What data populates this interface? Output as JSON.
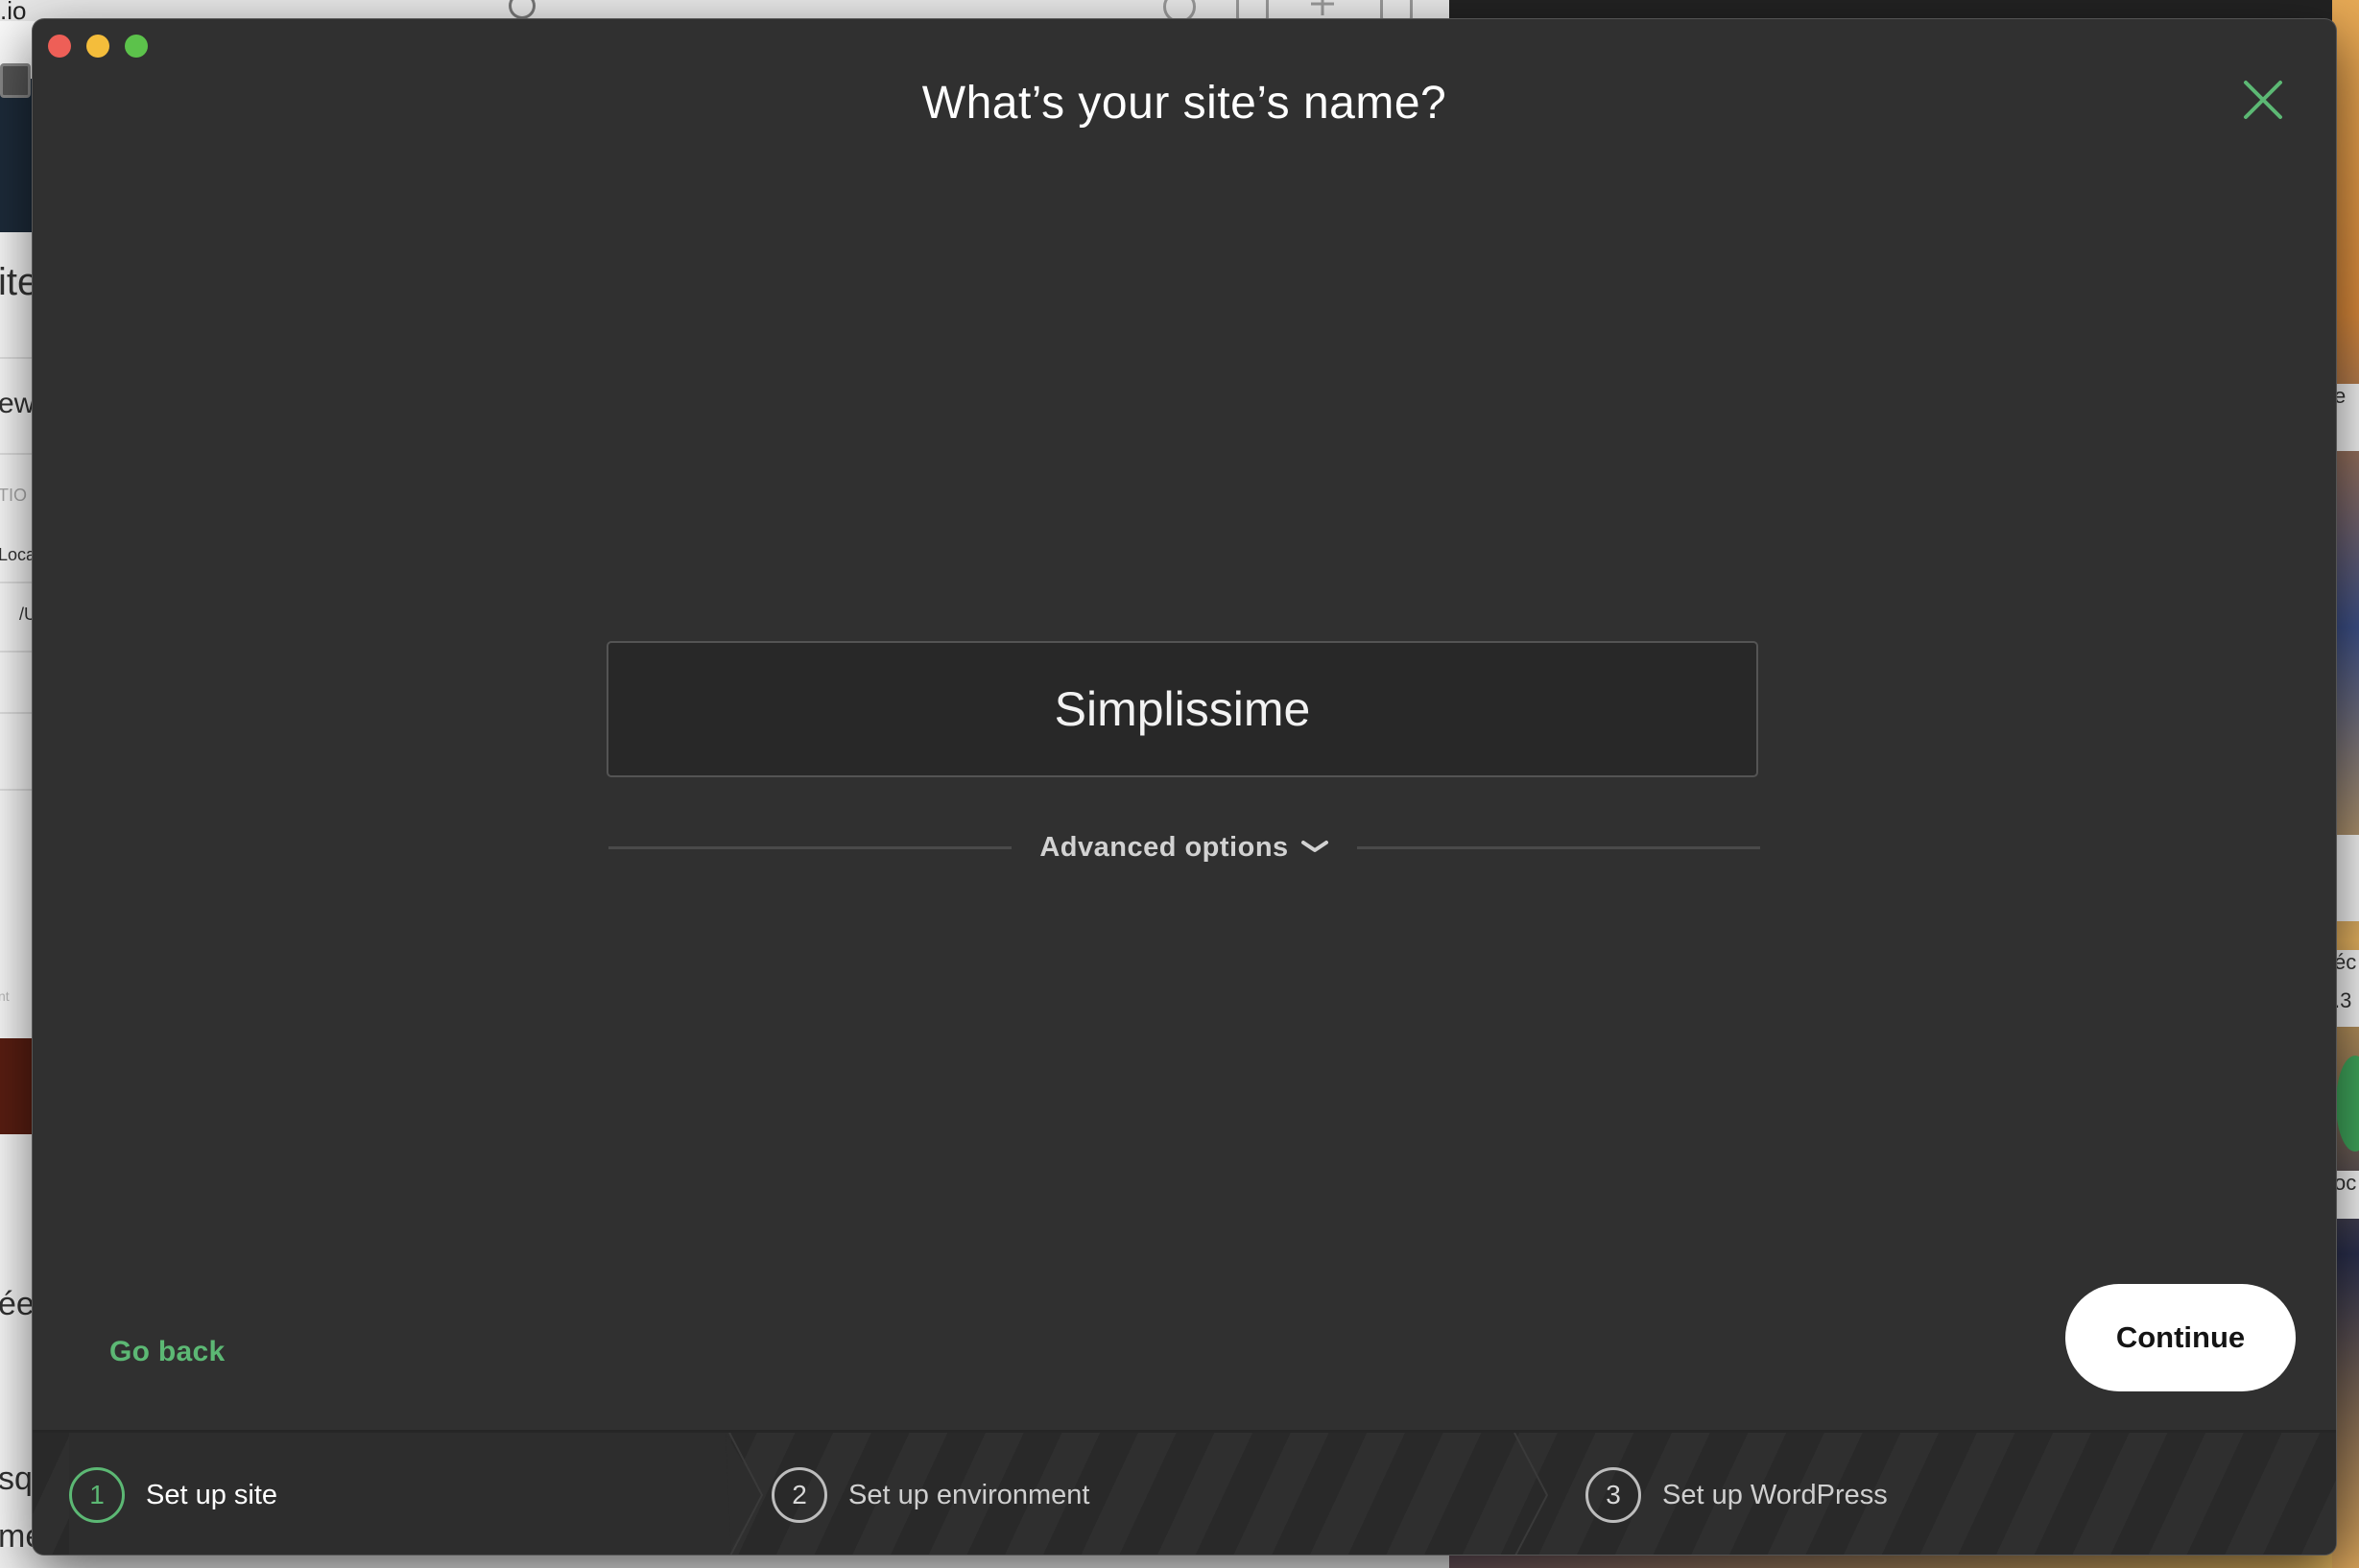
{
  "background": {
    "url_fragment": ".io",
    "left_fragments": [
      "ite",
      "ew",
      "TIO",
      "Loca",
      "/U",
      "nt",
      "ée",
      "squ",
      "me"
    ],
    "right_fragments": [
      "e",
      "éc",
      ".3",
      "oc"
    ]
  },
  "window": {
    "title": "What’s your site’s name?"
  },
  "form": {
    "site_name_value": "Simplissime",
    "advanced_options_label": "Advanced options"
  },
  "actions": {
    "go_back_label": "Go back",
    "continue_label": "Continue"
  },
  "steps": [
    {
      "number": "1",
      "label": "Set up site",
      "active": true
    },
    {
      "number": "2",
      "label": "Set up environment",
      "active": false
    },
    {
      "number": "3",
      "label": "Set up WordPress",
      "active": false
    }
  ],
  "colors": {
    "accent_green": "#5cb874",
    "window_bg": "#303030",
    "input_bg": "#282828",
    "continue_bg": "#ffffff"
  },
  "icons": {
    "close": "close-icon",
    "advanced_toggle": "chevron-down-icon"
  }
}
